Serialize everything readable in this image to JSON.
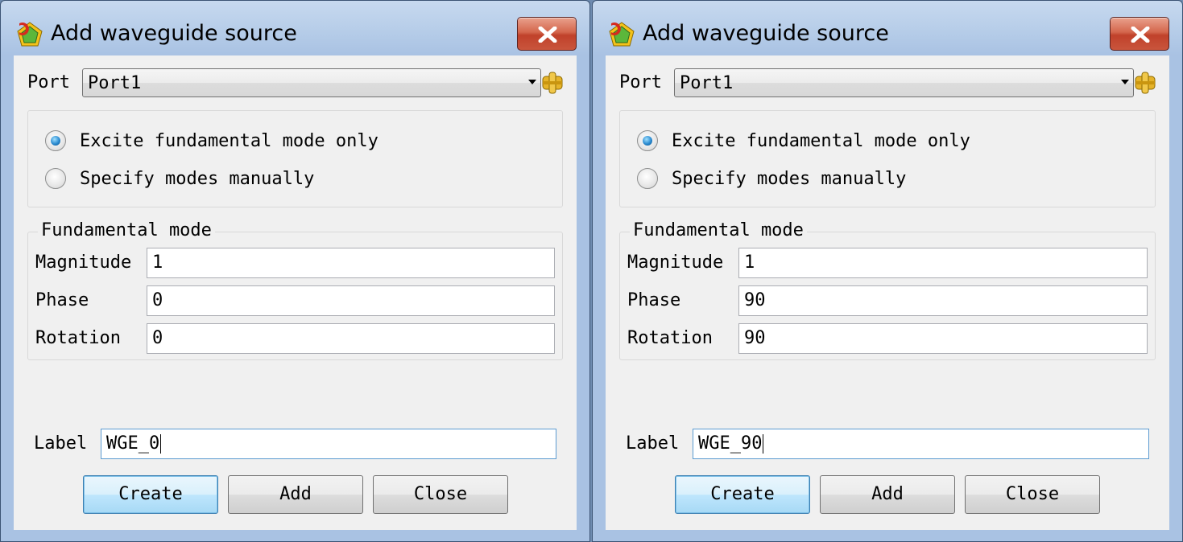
{
  "dialogs": [
    {
      "title": "Add waveguide source",
      "port_label": "Port",
      "port_value": "Port1",
      "excite_fundamental": "Excite fundamental mode only",
      "specify_manually": "Specify modes manually",
      "selected_mode_option": "Excite fundamental mode only",
      "fundamental_group": "Fundamental mode",
      "magnitude_label": "Magnitude",
      "magnitude_value": "1",
      "phase_label": "Phase",
      "phase_value": "0",
      "rotation_label": "Rotation",
      "rotation_value": "0",
      "label_label": "Label",
      "label_value": "WGE_0",
      "create_label": "Create",
      "add_label": "Add",
      "close_label": "Close"
    },
    {
      "title": "Add waveguide source",
      "port_label": "Port",
      "port_value": "Port1",
      "excite_fundamental": "Excite fundamental mode only",
      "specify_manually": "Specify modes manually",
      "selected_mode_option": "Excite fundamental mode only",
      "fundamental_group": "Fundamental mode",
      "magnitude_label": "Magnitude",
      "magnitude_value": "1",
      "phase_label": "Phase",
      "phase_value": "90",
      "rotation_label": "Rotation",
      "rotation_value": "90",
      "label_label": "Label",
      "label_value": "WGE_90",
      "create_label": "Create",
      "add_label": "Add",
      "close_label": "Close"
    }
  ],
  "icons": {
    "app": "app-logo-icon",
    "close": "close-icon",
    "pick": "pick-port-icon",
    "dropdown": "chevron-down-icon"
  },
  "colors": {
    "title_bar": "#b5cce8",
    "close_button": "#c9553c",
    "default_button": "#bee6fd",
    "radio_selected": "#2a8ad0"
  }
}
